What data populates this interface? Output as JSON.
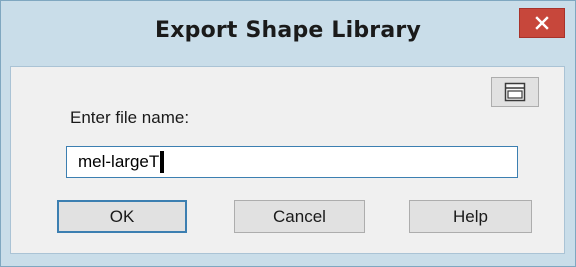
{
  "dialog": {
    "title": "Export Shape Library",
    "close_icon": "close-icon",
    "browse_icon": "folder-browse-icon"
  },
  "form": {
    "label": "Enter file name:",
    "filename_value": "mel-largeT"
  },
  "buttons": {
    "ok": "OK",
    "cancel": "Cancel",
    "help": "Help"
  },
  "colors": {
    "titlebar": "#c9dde9",
    "close_button": "#c7473b",
    "focus_border": "#3c7fb1"
  }
}
